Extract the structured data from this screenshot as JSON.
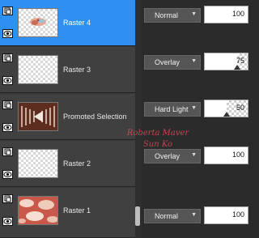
{
  "layers": [
    {
      "name": "Raster 4",
      "blend_mode": "Normal",
      "opacity": 100,
      "selected": true,
      "thumbnail": "decoration-thumbnail"
    },
    {
      "name": "Raster 3",
      "blend_mode": "Overlay",
      "opacity": 75,
      "selected": false,
      "thumbnail": "transparent-thumbnail"
    },
    {
      "name": "Promoted Selection",
      "blend_mode": "Hard Light",
      "opacity": 50,
      "selected": false,
      "thumbnail": "brown-pattern-thumbnail"
    },
    {
      "name": "Raster 2",
      "blend_mode": "Overlay",
      "opacity": 100,
      "selected": false,
      "thumbnail": "transparent-thumbnail"
    },
    {
      "name": "Raster 1",
      "blend_mode": "Normal",
      "opacity": 100,
      "selected": false,
      "thumbnail": "red-pattern-thumbnail"
    }
  ],
  "watermark": {
    "line1": "Roberta Maver",
    "line2": "Sun Ko"
  },
  "colors": {
    "selected_row": "#2f90f4",
    "panel_bg": "#2b2b2b",
    "row_bg": "#404040"
  }
}
